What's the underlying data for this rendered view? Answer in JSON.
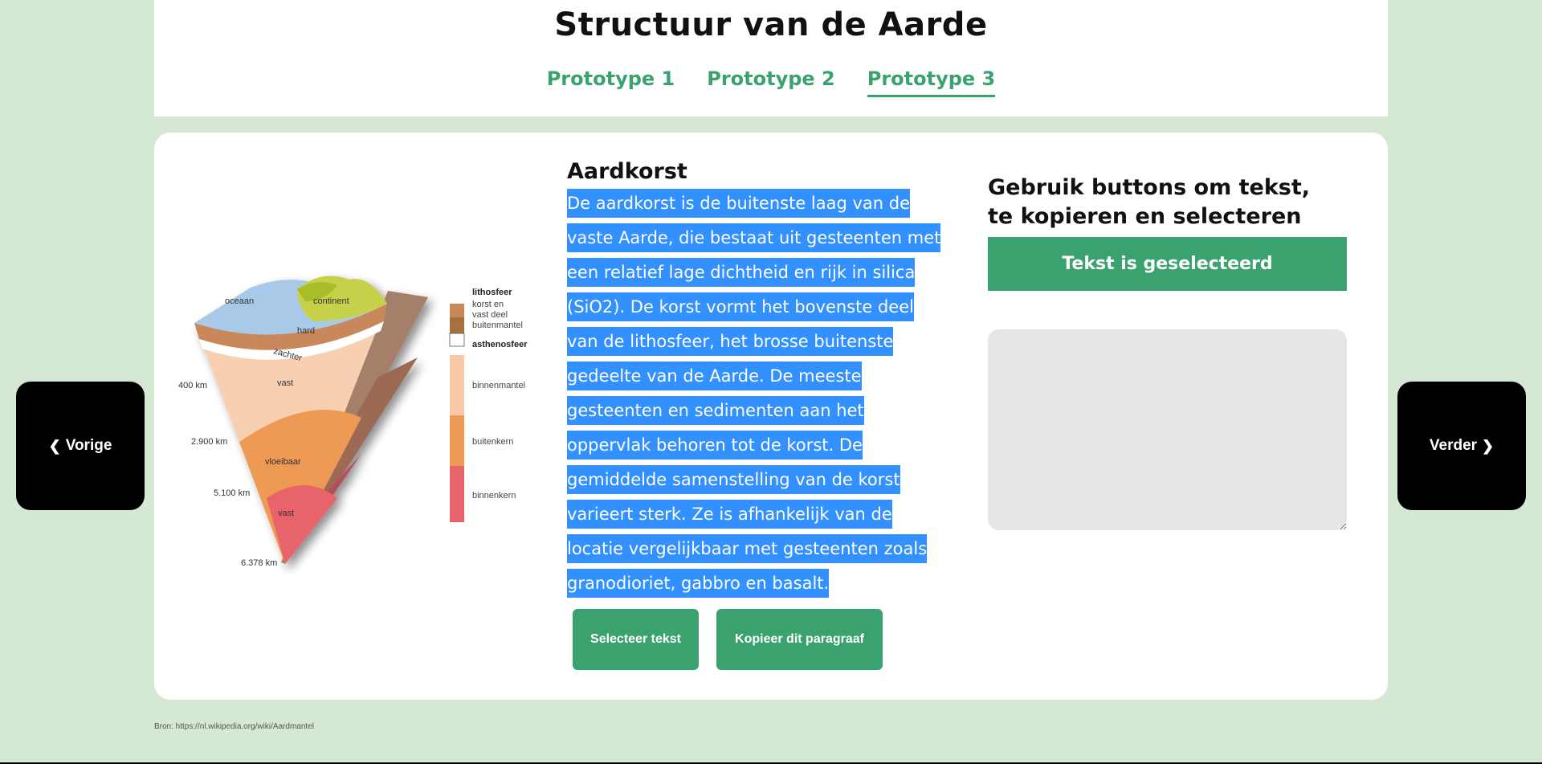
{
  "header": {
    "title": "Structuur van de Aarde",
    "tabs": [
      {
        "label": "Prototype 1",
        "active": false
      },
      {
        "label": "Prototype 2",
        "active": false
      },
      {
        "label": "Prototype 3",
        "active": true
      }
    ]
  },
  "nav": {
    "prev_label": "Vorige",
    "next_label": "Verder"
  },
  "diagram": {
    "surface_labels": [
      "oceaan",
      "continent"
    ],
    "layer_labels": [
      "hard",
      "zachter",
      "vast",
      "vloeibaar",
      "vast"
    ],
    "depth_labels": [
      "400 km",
      "2.900 km",
      "5.100 km",
      "6.378 km"
    ],
    "legend": {
      "lithosfeer_title": "lithosfeer",
      "lithosfeer_sub": [
        "korst en",
        "vast deel",
        "buitenmantel"
      ],
      "asthenosfeer": "asthenosfeer",
      "binnenmantel": "binnenmantel",
      "buitenkern": "buitenkern",
      "binnenkern": "binnenkern"
    }
  },
  "article": {
    "heading": "Aardkorst",
    "paragraph": "De aardkorst is de buitenste laag van de vaste Aarde, die bestaat uit gesteenten met een relatief lage dichtheid en rijk in silica (SiO2). De korst vormt het bovenste deel van de lithosfeer, het brosse buitenste gedeelte van de Aarde. De meeste gesteenten en sedimenten aan het oppervlak behoren tot de korst. De gemiddelde samenstelling van de korst varieert sterk. Ze is afhankelijk van de locatie vergelijkbaar met gesteenten zoals granodioriet, gabbro en basalt.",
    "select_button": "Selecteer tekst",
    "copy_button": "Kopieer dit paragraaf"
  },
  "panel": {
    "heading": "Gebruik buttons om tekst, te kopieren en selecteren",
    "status": "Tekst is geselecteerd",
    "textarea_value": ""
  },
  "footer": {
    "source": "Bron: https://nl.wikipedia.org/wiki/Aardmantel"
  },
  "colors": {
    "background": "#d4e8d4",
    "accent": "#3aa26f",
    "selection": "#3390ff",
    "nav_button": "#000000"
  }
}
